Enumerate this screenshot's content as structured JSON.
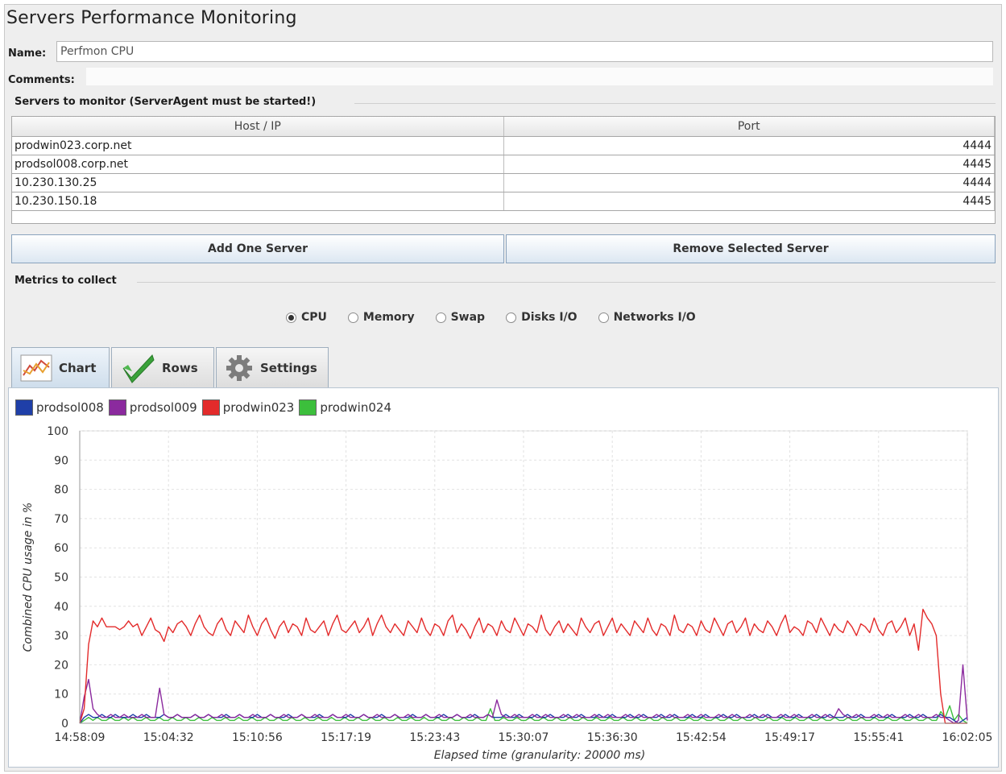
{
  "window": {
    "title": "Servers Performance Monitoring"
  },
  "name": {
    "label": "Name:",
    "value": "Perfmon CPU"
  },
  "comments": {
    "label": "Comments:"
  },
  "servers": {
    "group_title": "Servers to monitor (ServerAgent must be started!)",
    "columns": [
      "Host / IP",
      "Port"
    ],
    "rows": [
      {
        "host": "prodwin023.corp.net",
        "port": "4444"
      },
      {
        "host": "prodsol008.corp.net",
        "port": "4445"
      },
      {
        "host": "10.230.130.25",
        "port": "4444"
      },
      {
        "host": "10.230.150.18",
        "port": "4445"
      }
    ],
    "add_button": "Add One Server",
    "remove_button": "Remove Selected Server"
  },
  "metrics": {
    "group_title": "Metrics to collect",
    "options": [
      "CPU",
      "Memory",
      "Swap",
      "Disks I/O",
      "Networks I/O"
    ],
    "selected": "CPU"
  },
  "tabs": [
    {
      "label": "Chart",
      "icon": "chart-icon",
      "active": true
    },
    {
      "label": "Rows",
      "icon": "checkmark-icon",
      "active": false
    },
    {
      "label": "Settings",
      "icon": "gear-icon",
      "active": false
    }
  ],
  "colors": {
    "prodsol008": "#1f3fa8",
    "prodsol009": "#8b2a9e",
    "prodwin023": "#e32b2b",
    "prodwin024": "#3cbf3c"
  },
  "chart_data": {
    "type": "line",
    "ylabel": "Combined CPU usage in %",
    "xlabel": "Elapsed time (granularity: 20000 ms)",
    "ylim": [
      0,
      100
    ],
    "yticks": [
      "0",
      "10",
      "20",
      "30",
      "40",
      "50",
      "60",
      "70",
      "80",
      "90",
      "100"
    ],
    "xticks": [
      "14:58:09",
      "15:04:32",
      "15:10:56",
      "15:17:19",
      "15:23:43",
      "15:30:07",
      "15:36:30",
      "15:42:54",
      "15:49:17",
      "15:55:41",
      "16:02:05"
    ],
    "grid": true,
    "legend_position": "top-left",
    "x_note": "x values are sample indices 0..200 spanning the tick range",
    "series": [
      {
        "name": "prodsol008",
        "color": "#1f3fa8",
        "values": [
          0,
          2,
          3,
          2,
          2,
          3,
          2,
          2,
          3,
          2,
          2,
          2,
          3,
          2,
          2,
          3,
          2,
          2,
          2,
          3,
          2,
          2,
          3,
          2,
          2,
          2,
          3,
          2,
          2,
          3,
          2,
          2,
          2,
          3,
          2,
          2,
          3,
          2,
          2,
          2,
          3,
          2,
          2,
          3,
          2,
          2,
          2,
          3,
          2,
          2,
          3,
          2,
          2,
          2,
          3,
          2,
          2,
          3,
          2,
          2,
          2,
          3,
          2,
          2,
          3,
          2,
          2,
          2,
          3,
          2,
          2,
          3,
          2,
          2,
          2,
          3,
          2,
          2,
          3,
          2,
          2,
          2,
          3,
          2,
          2,
          3,
          2,
          2,
          2,
          3,
          2,
          2,
          3,
          2,
          2,
          2,
          3,
          2,
          2,
          3,
          2,
          2,
          2,
          3,
          2,
          2,
          3,
          2,
          2,
          2,
          3,
          2,
          2,
          3,
          2,
          2,
          2,
          3,
          2,
          2,
          3,
          2,
          2,
          2,
          3,
          2,
          2,
          3,
          2,
          2,
          2,
          3,
          2,
          2,
          3,
          2,
          2,
          2,
          3,
          2,
          2,
          3,
          2,
          2,
          2,
          3,
          2,
          2,
          3,
          2,
          2,
          2,
          3,
          2,
          2,
          3,
          2,
          2,
          2,
          3,
          2,
          2,
          3,
          2,
          2,
          2,
          3,
          2,
          2,
          3,
          2,
          2,
          2,
          3,
          2,
          2,
          3,
          2,
          2,
          2,
          3,
          2,
          2,
          3,
          2,
          2,
          2,
          3,
          2,
          2,
          3,
          2,
          2,
          2,
          3,
          2,
          2,
          1,
          0,
          1,
          2
        ]
      },
      {
        "name": "prodsol009",
        "color": "#8b2a9e",
        "values": [
          0,
          9,
          15,
          5,
          3,
          2,
          2,
          3,
          2,
          2,
          3,
          2,
          2,
          2,
          3,
          2,
          2,
          2,
          12,
          3,
          2,
          2,
          3,
          2,
          2,
          2,
          3,
          2,
          2,
          3,
          2,
          2,
          3,
          2,
          2,
          2,
          3,
          2,
          2,
          3,
          2,
          2,
          2,
          3,
          2,
          2,
          3,
          2,
          2,
          2,
          3,
          2,
          2,
          3,
          2,
          2,
          2,
          3,
          2,
          2,
          3,
          2,
          2,
          2,
          3,
          2,
          2,
          3,
          2,
          2,
          2,
          3,
          2,
          2,
          3,
          2,
          2,
          2,
          3,
          2,
          2,
          3,
          2,
          2,
          2,
          3,
          2,
          2,
          3,
          2,
          2,
          2,
          3,
          2,
          8,
          3,
          2,
          2,
          3,
          2,
          2,
          2,
          3,
          2,
          2,
          3,
          2,
          2,
          2,
          3,
          2,
          2,
          3,
          2,
          2,
          2,
          3,
          2,
          2,
          3,
          2,
          2,
          2,
          3,
          2,
          2,
          3,
          2,
          2,
          2,
          3,
          2,
          2,
          3,
          2,
          2,
          2,
          3,
          2,
          2,
          3,
          2,
          2,
          2,
          3,
          2,
          2,
          3,
          2,
          2,
          2,
          3,
          2,
          2,
          3,
          2,
          2,
          2,
          3,
          2,
          2,
          3,
          2,
          2,
          2,
          3,
          2,
          2,
          3,
          2,
          2,
          5,
          3,
          2,
          2,
          3,
          2,
          2,
          2,
          3,
          2,
          2,
          3,
          2,
          2,
          2,
          3,
          2,
          2,
          3,
          2,
          2,
          2,
          3,
          2,
          2,
          1,
          0,
          1,
          20,
          1
        ]
      },
      {
        "name": "prodwin023",
        "color": "#e32b2b",
        "values": [
          0,
          5,
          27,
          35,
          33,
          36,
          33,
          33,
          33,
          32,
          33,
          35,
          33,
          34,
          30,
          33,
          36,
          32,
          31,
          28,
          33,
          31,
          34,
          35,
          33,
          30,
          34,
          37,
          33,
          31,
          30,
          34,
          36,
          32,
          30,
          35,
          33,
          31,
          37,
          33,
          30,
          34,
          36,
          32,
          29,
          33,
          35,
          31,
          34,
          33,
          30,
          36,
          32,
          31,
          33,
          35,
          30,
          34,
          37,
          32,
          31,
          33,
          35,
          31,
          33,
          36,
          30,
          34,
          37,
          33,
          31,
          34,
          32,
          30,
          35,
          33,
          31,
          36,
          32,
          30,
          34,
          33,
          30,
          35,
          37,
          31,
          34,
          32,
          29,
          33,
          36,
          31,
          34,
          33,
          30,
          35,
          32,
          31,
          36,
          33,
          30,
          34,
          33,
          31,
          37,
          32,
          30,
          33,
          35,
          31,
          34,
          32,
          30,
          36,
          33,
          31,
          34,
          35,
          30,
          33,
          36,
          31,
          34,
          32,
          30,
          35,
          33,
          31,
          36,
          32,
          30,
          34,
          33,
          30,
          37,
          32,
          31,
          34,
          33,
          30,
          35,
          32,
          31,
          36,
          33,
          30,
          34,
          35,
          31,
          33,
          36,
          30,
          34,
          32,
          31,
          35,
          33,
          30,
          34,
          37,
          31,
          33,
          32,
          30,
          35,
          34,
          31,
          36,
          33,
          30,
          34,
          32,
          31,
          35,
          33,
          30,
          34,
          33,
          31,
          36,
          32,
          30,
          34,
          35,
          31,
          33,
          36,
          30,
          34,
          25,
          39,
          36,
          34,
          30,
          10,
          0,
          0,
          0,
          0,
          0,
          0
        ]
      },
      {
        "name": "prodwin024",
        "color": "#3cbf3c",
        "values": [
          0,
          1,
          2,
          1,
          2,
          1,
          1,
          2,
          1,
          1,
          2,
          1,
          2,
          1,
          1,
          2,
          1,
          1,
          2,
          1,
          1,
          2,
          1,
          1,
          2,
          1,
          1,
          2,
          1,
          1,
          2,
          1,
          1,
          2,
          1,
          1,
          2,
          1,
          1,
          2,
          1,
          1,
          2,
          1,
          1,
          2,
          1,
          1,
          2,
          1,
          1,
          2,
          1,
          1,
          2,
          1,
          1,
          2,
          1,
          1,
          2,
          1,
          1,
          2,
          1,
          1,
          2,
          1,
          1,
          2,
          1,
          1,
          2,
          1,
          1,
          2,
          1,
          1,
          2,
          1,
          1,
          2,
          1,
          1,
          2,
          1,
          1,
          2,
          1,
          1,
          2,
          1,
          1,
          5,
          1,
          1,
          2,
          1,
          1,
          2,
          1,
          1,
          2,
          1,
          1,
          2,
          1,
          1,
          2,
          1,
          1,
          2,
          1,
          1,
          2,
          1,
          1,
          2,
          1,
          1,
          2,
          1,
          1,
          2,
          1,
          1,
          2,
          1,
          1,
          2,
          1,
          1,
          2,
          1,
          1,
          2,
          1,
          1,
          2,
          1,
          1,
          2,
          1,
          1,
          2,
          1,
          1,
          2,
          1,
          1,
          2,
          1,
          1,
          2,
          1,
          1,
          2,
          1,
          1,
          2,
          1,
          1,
          2,
          1,
          1,
          2,
          1,
          1,
          2,
          1,
          1,
          2,
          1,
          1,
          2,
          1,
          1,
          2,
          1,
          1,
          2,
          1,
          1,
          2,
          1,
          1,
          2,
          1,
          1,
          2,
          1,
          1,
          2,
          1,
          1,
          4,
          2,
          6,
          1,
          3,
          1,
          0
        ]
      }
    ]
  }
}
